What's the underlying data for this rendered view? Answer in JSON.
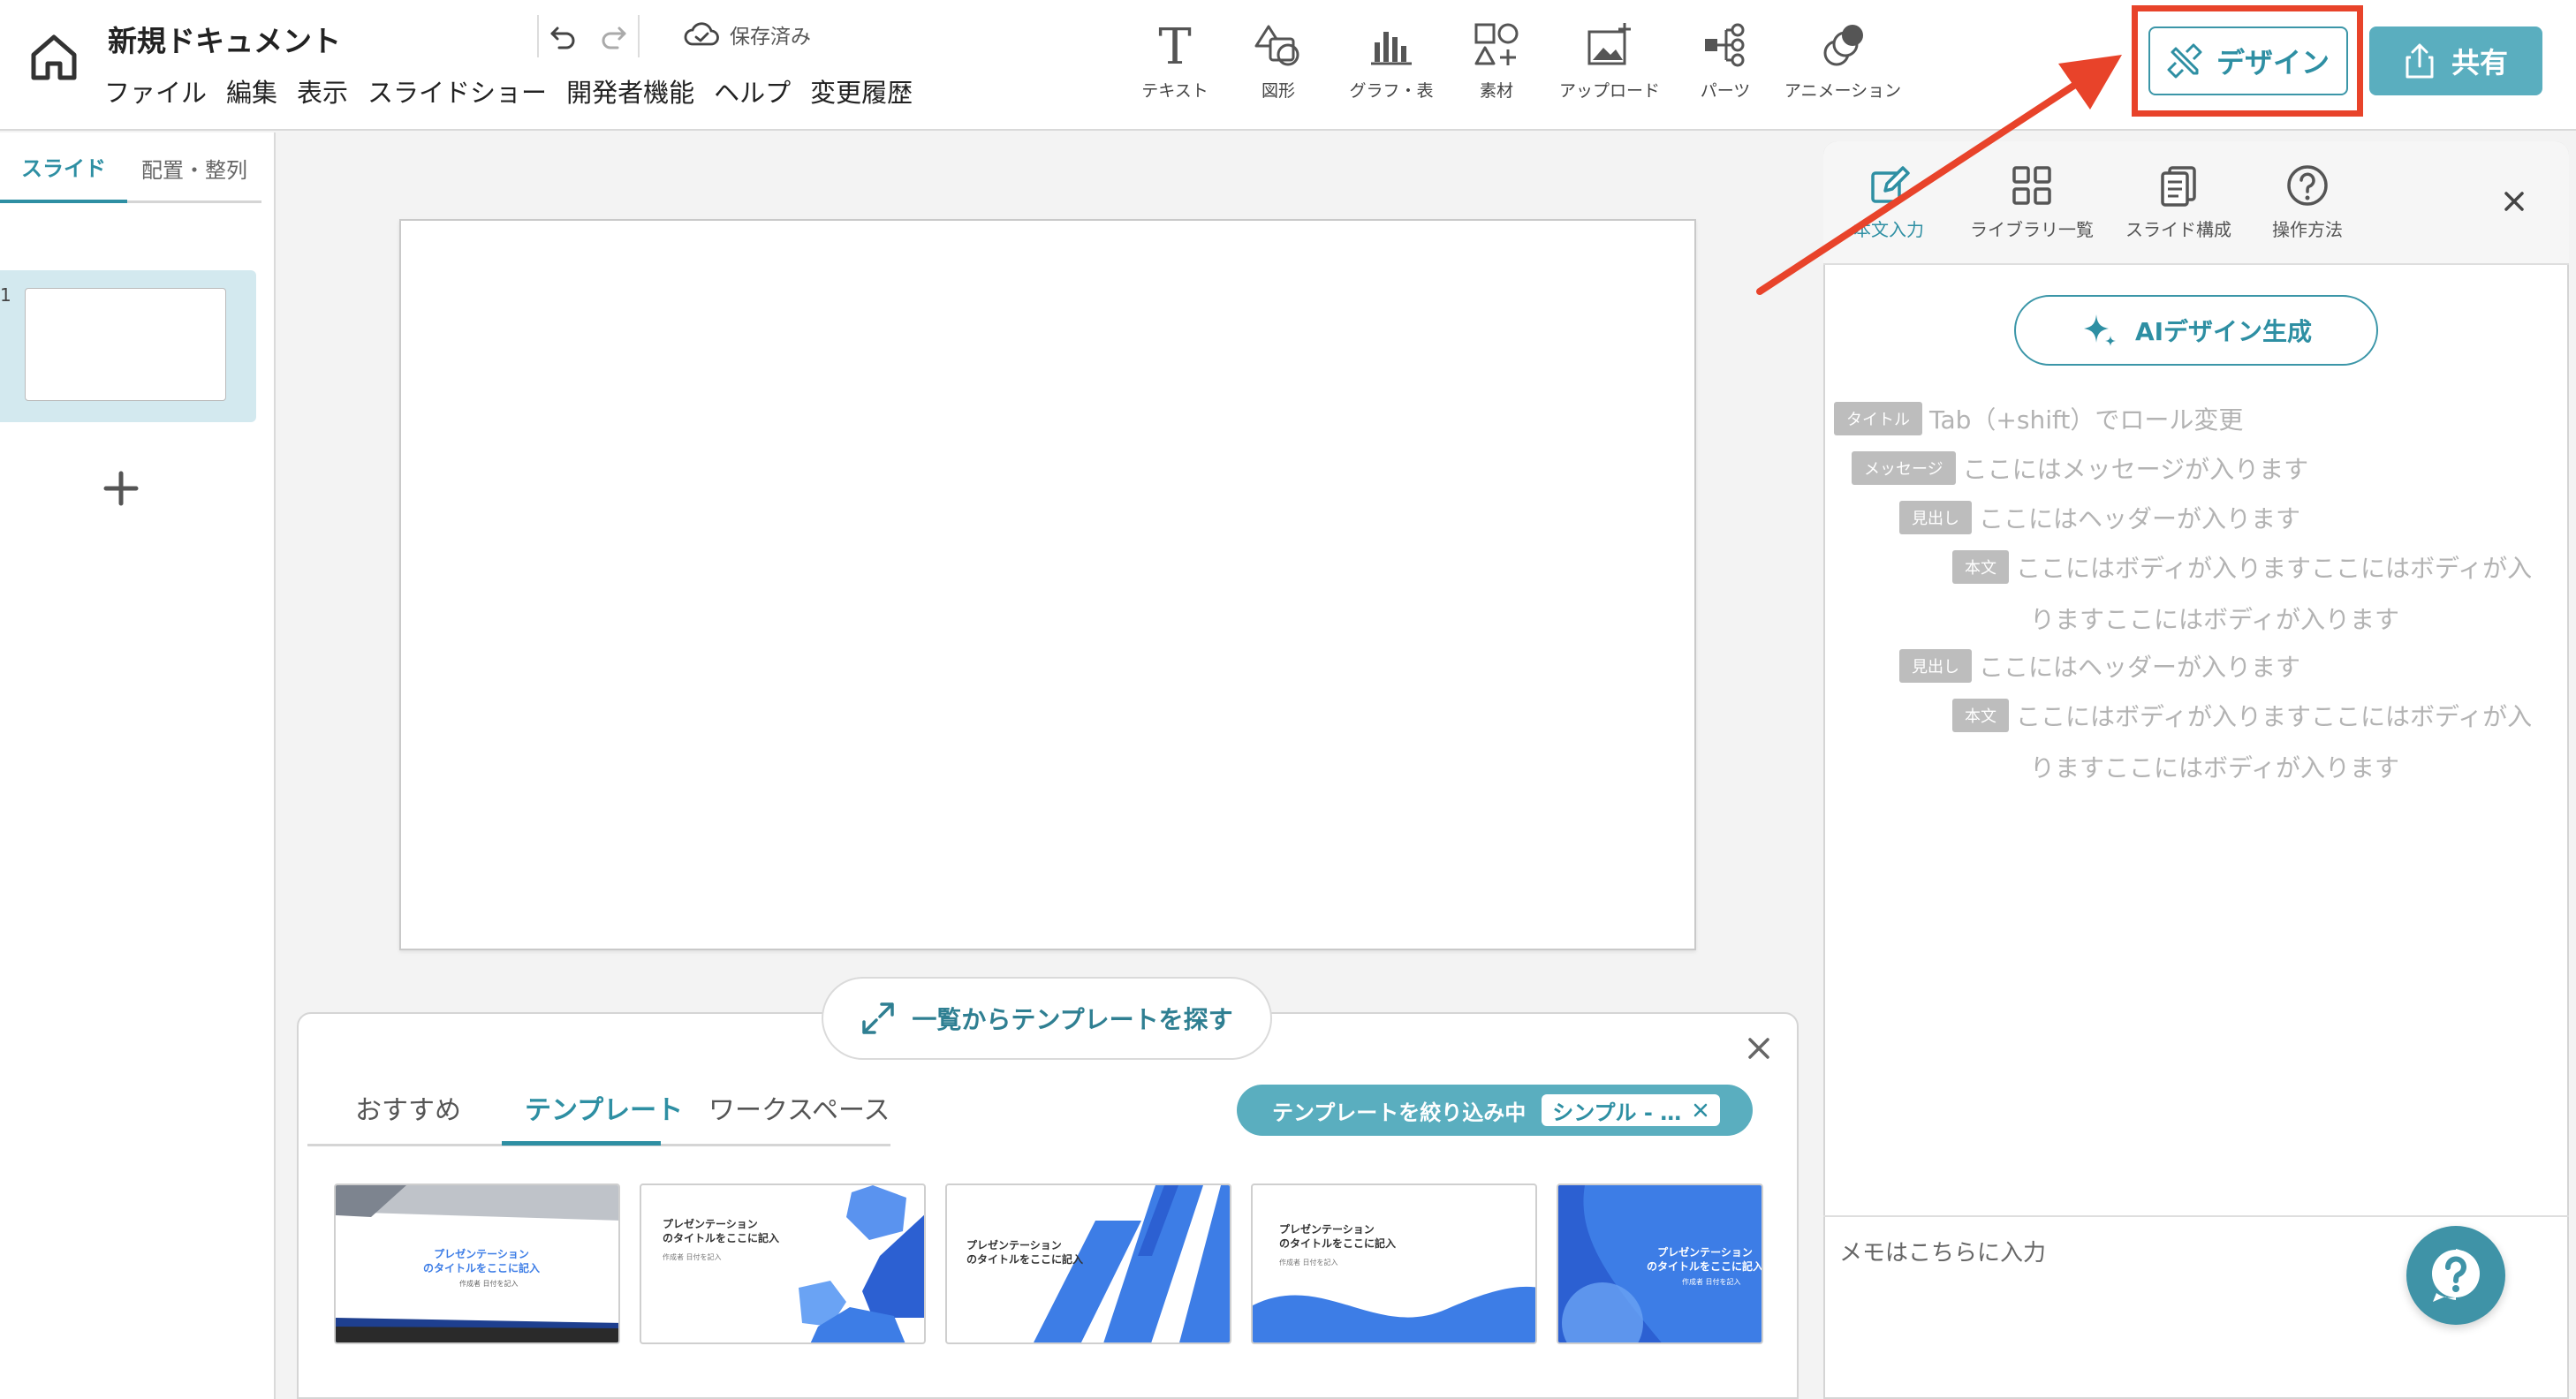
{
  "header": {
    "doc_title": "新規ドキュメント",
    "menu": [
      "ファイル",
      "編集",
      "表示",
      "スライドショー",
      "開発者機能",
      "ヘルプ",
      "変更履歴"
    ],
    "save_status": "保存済み",
    "tools": [
      {
        "label": "テキスト",
        "icon": "text-icon"
      },
      {
        "label": "図形",
        "icon": "shapes-icon"
      },
      {
        "label": "グラフ・表",
        "icon": "chart-icon"
      },
      {
        "label": "素材",
        "icon": "assets-icon"
      },
      {
        "label": "アップロード",
        "icon": "upload-image-icon"
      },
      {
        "label": "パーツ",
        "icon": "parts-icon"
      },
      {
        "label": "アニメーション",
        "icon": "animation-icon"
      }
    ],
    "design_label": "デザイン",
    "share_label": "共有"
  },
  "left_panel": {
    "tabs": [
      "スライド",
      "配置・整列"
    ],
    "active_tab": "スライド",
    "slide_number": "1"
  },
  "template_panel": {
    "find_label": "一覧からテンプレートを探す",
    "tabs": [
      "おすすめ",
      "テンプレート",
      "ワークスペース"
    ],
    "active_tab": "テンプレート",
    "filter_label": "テンプレートを絞り込み中",
    "filter_tag": "シンプル - …",
    "cards": [
      {
        "title": "プレゼンテーション\nのタイトルをここに記入",
        "sub": "作成者 日付を記入"
      },
      {
        "title": "プレゼンテーション\nのタイトルをここに記入",
        "sub": "作成者 日付を記入"
      },
      {
        "title": "プレゼンテーション\nのタイトルをここに記入",
        "sub": ""
      },
      {
        "title": "プレゼンテーション\nのタイトルをここに記入",
        "sub": "作成者 日付を記入"
      },
      {
        "title": "プレゼンテーション\nのタイトルをここに記入",
        "sub": "作成者 日付を記入"
      }
    ]
  },
  "right_panel": {
    "tabs": [
      {
        "label": "本文入力",
        "icon": "edit-icon"
      },
      {
        "label": "ライブラリ一覧",
        "icon": "grid-icon"
      },
      {
        "label": "スライド構成",
        "icon": "pages-icon"
      },
      {
        "label": "操作方法",
        "icon": "question-icon"
      }
    ],
    "active_tab": "本文入力",
    "ai_button": "AIデザイン生成",
    "outline": [
      {
        "badge": "タイトル",
        "text": "Tab（+shift）でロール変更"
      },
      {
        "badge": "メッセージ",
        "text": "ここにはメッセージが入ります"
      },
      {
        "badge": "見出し",
        "text": "ここにはヘッダーが入ります"
      },
      {
        "badge": "本文",
        "text": "ここにはボディが入りますここにはボディが入",
        "text2": "りますここにはボディが入ります"
      },
      {
        "badge": "見出し",
        "text": "ここにはヘッダーが入ります"
      },
      {
        "badge": "本文",
        "text": "ここにはボディが入りますここにはボディが入",
        "text2": "りますここにはボディが入ります"
      }
    ],
    "memo_placeholder": "メモはこちらに入力"
  },
  "colors": {
    "accent": "#2e8fa3",
    "share_bg": "#5aaebf",
    "highlight": "#e8432a",
    "slide_selected_bg": "#d3e9ef",
    "template_blue": "#3d7de6"
  }
}
